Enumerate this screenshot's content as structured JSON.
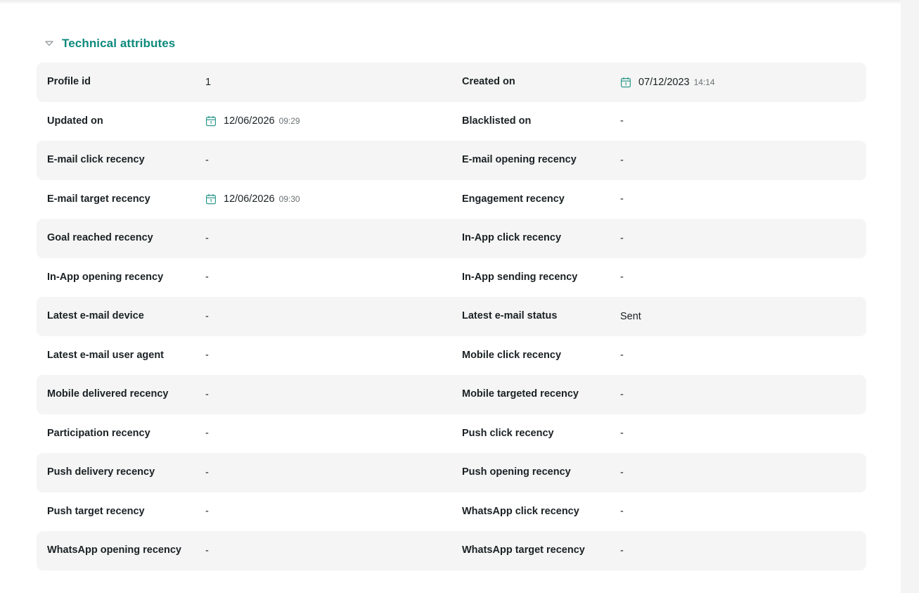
{
  "section": {
    "title": "Technical attributes",
    "expanded": true,
    "accent_color": "#0d8a7c"
  },
  "rows": [
    {
      "left": {
        "label": "Profile id",
        "value": "1",
        "date": "",
        "time": ""
      },
      "right": {
        "label": "Created on",
        "value": "",
        "date": "07/12/2023",
        "time": "14:14"
      }
    },
    {
      "left": {
        "label": "Updated on",
        "value": "",
        "date": "12/06/2026",
        "time": "09:29"
      },
      "right": {
        "label": "Blacklisted on",
        "value": "-",
        "date": "",
        "time": ""
      }
    },
    {
      "left": {
        "label": "E-mail click recency",
        "value": "-",
        "date": "",
        "time": ""
      },
      "right": {
        "label": "E-mail opening recency",
        "value": "-",
        "date": "",
        "time": ""
      }
    },
    {
      "left": {
        "label": "E-mail target recency",
        "value": "",
        "date": "12/06/2026",
        "time": "09:30"
      },
      "right": {
        "label": "Engagement recency",
        "value": "-",
        "date": "",
        "time": ""
      }
    },
    {
      "left": {
        "label": "Goal reached recency",
        "value": "-",
        "date": "",
        "time": ""
      },
      "right": {
        "label": "In-App click recency",
        "value": "-",
        "date": "",
        "time": ""
      }
    },
    {
      "left": {
        "label": "In-App opening recency",
        "value": "-",
        "date": "",
        "time": ""
      },
      "right": {
        "label": "In-App sending recency",
        "value": "-",
        "date": "",
        "time": ""
      }
    },
    {
      "left": {
        "label": "Latest e-mail device",
        "value": "-",
        "date": "",
        "time": ""
      },
      "right": {
        "label": "Latest e-mail status",
        "value": "Sent",
        "date": "",
        "time": ""
      }
    },
    {
      "left": {
        "label": "Latest e-mail user agent",
        "value": "-",
        "date": "",
        "time": ""
      },
      "right": {
        "label": "Mobile click recency",
        "value": "-",
        "date": "",
        "time": ""
      }
    },
    {
      "left": {
        "label": "Mobile delivered recency",
        "value": "-",
        "date": "",
        "time": ""
      },
      "right": {
        "label": "Mobile targeted recency",
        "value": "-",
        "date": "",
        "time": ""
      }
    },
    {
      "left": {
        "label": "Participation recency",
        "value": "-",
        "date": "",
        "time": ""
      },
      "right": {
        "label": "Push click recency",
        "value": "-",
        "date": "",
        "time": ""
      }
    },
    {
      "left": {
        "label": "Push delivery recency",
        "value": "-",
        "date": "",
        "time": ""
      },
      "right": {
        "label": "Push opening recency",
        "value": "-",
        "date": "",
        "time": ""
      }
    },
    {
      "left": {
        "label": "Push target recency",
        "value": "-",
        "date": "",
        "time": ""
      },
      "right": {
        "label": "WhatsApp click recency",
        "value": "-",
        "date": "",
        "time": ""
      }
    },
    {
      "left": {
        "label": "WhatsApp opening recency",
        "value": "-",
        "date": "",
        "time": ""
      },
      "right": {
        "label": "WhatsApp target recency",
        "value": "-",
        "date": "",
        "time": ""
      }
    }
  ],
  "icons": {
    "toggle": "chevron-down-icon",
    "date": "calendar-icon"
  },
  "colors": {
    "row_shade": "#f4f5f4",
    "calendar_icon": "#2e9a8c"
  }
}
